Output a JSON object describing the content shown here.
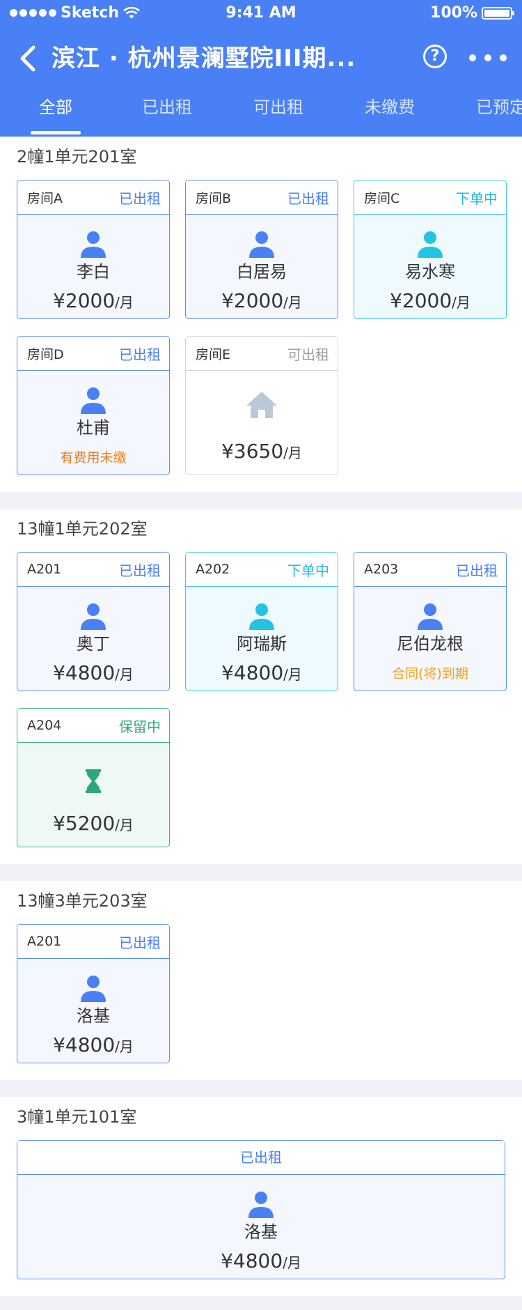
{
  "status_bar": {
    "carrier": "Sketch",
    "time": "9:41 AM",
    "battery": "100%"
  },
  "nav": {
    "title": "滨江 · 杭州景澜墅院III期...",
    "help_icon": "question-circle-icon",
    "more_icon": "more-dots-icon"
  },
  "tabs": [
    "全部",
    "已出租",
    "可出租",
    "未缴费",
    "已预定"
  ],
  "colors": {
    "primary": "#4a80f5",
    "cyan": "#23b8d8",
    "green": "#2aa87b",
    "orange": "#f07a1a",
    "amber": "#f0a020",
    "gray": "#9aa0aa"
  },
  "sections": [
    {
      "title": "2幢1单元201室",
      "rooms": [
        {
          "room": "房间A",
          "status": "已出租",
          "name": "李白",
          "price": "¥2000",
          "unit": "/月"
        },
        {
          "room": "房间B",
          "status": "已出租",
          "name": "白居易",
          "price": "¥2000",
          "unit": "/月"
        },
        {
          "room": "房间C",
          "status": "下单中",
          "name": "易水寒",
          "price": "¥2000",
          "unit": "/月"
        },
        {
          "room": "房间D",
          "status": "已出租",
          "name": "杜甫",
          "note": "有费用未缴"
        },
        {
          "room": "房间E",
          "status": "可出租",
          "price": "¥3650",
          "unit": "/月"
        }
      ]
    },
    {
      "title": "13幢1单元202室",
      "rooms": [
        {
          "room": "A201",
          "status": "已出租",
          "name": "奥丁",
          "price": "¥4800",
          "unit": "/月"
        },
        {
          "room": "A202",
          "status": "下单中",
          "name": "阿瑞斯",
          "price": "¥4800",
          "unit": "/月"
        },
        {
          "room": "A203",
          "status": "已出租",
          "name": "尼伯龙根",
          "note": "合同(将)到期"
        },
        {
          "room": "A204",
          "status": "保留中",
          "price": "¥5200",
          "unit": "/月"
        }
      ]
    },
    {
      "title": "13幢3单元203室",
      "rooms": [
        {
          "room": "A201",
          "status": "已出租",
          "name": "洛基",
          "price": "¥4800",
          "unit": "/月"
        }
      ]
    },
    {
      "title": "3幢1单元101室",
      "whole": {
        "status": "已出租",
        "name": "洛基",
        "price": "¥4800",
        "unit": "/月"
      }
    }
  ]
}
